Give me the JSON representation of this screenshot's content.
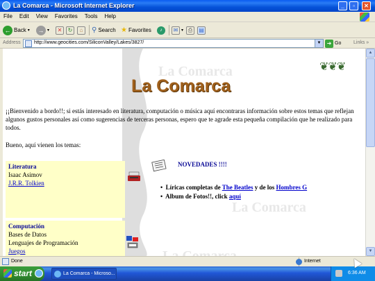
{
  "window": {
    "title": "La Comarca - Microsoft Internet Explorer"
  },
  "menu": [
    "File",
    "Edit",
    "View",
    "Favorites",
    "Tools",
    "Help"
  ],
  "toolbar": {
    "back": "Back",
    "search": "Search",
    "favorites": "Favorites"
  },
  "address": {
    "label": "Address",
    "url": "http://www.geocities.com/SiliconValley/Lakes/3827/",
    "go": "Go",
    "links": "Links"
  },
  "page": {
    "title": "La Comarca",
    "watermark": "La Comarca",
    "intro": "¡¡Bienvenido a bordo!!;  si estás interesado en literatura, computación o música aquí encontraras información sobre estos temas que reflejan algunos gustos personales así como sugerencias de terceras personas, espero que te agrade esta pequeña compilación que he realizado para todos.",
    "intro2": "Bueno, aquí vienen los temas:",
    "literatura": {
      "heading": "Literatura",
      "items": [
        "Isaac Asimov",
        "J.R.R. Tolkien"
      ]
    },
    "computacion": {
      "heading": "Computación",
      "items": [
        "Bases de Datos",
        "Lenguajes de Programación",
        "Juegos"
      ]
    },
    "novedades": "NOVEDADES !!!!",
    "bullet1": {
      "prefix": "Líricas completas de",
      "link1": "The Beatles",
      "mid": "y de los",
      "link2": "Hombres G"
    },
    "bullet2": {
      "prefix": "Album de Fotos!!, click",
      "link": "aquí"
    }
  },
  "status": {
    "text": "Done",
    "zone": "Internet"
  },
  "taskbar": {
    "start": "start",
    "item": "La Comarca - Microso...",
    "clock": "6:36 AM"
  },
  "colors": {
    "title_brown": "#a0601c",
    "link_blue": "#0000cc",
    "heading_navy": "#0a0a96",
    "box_yellow": "#ffffc8"
  }
}
